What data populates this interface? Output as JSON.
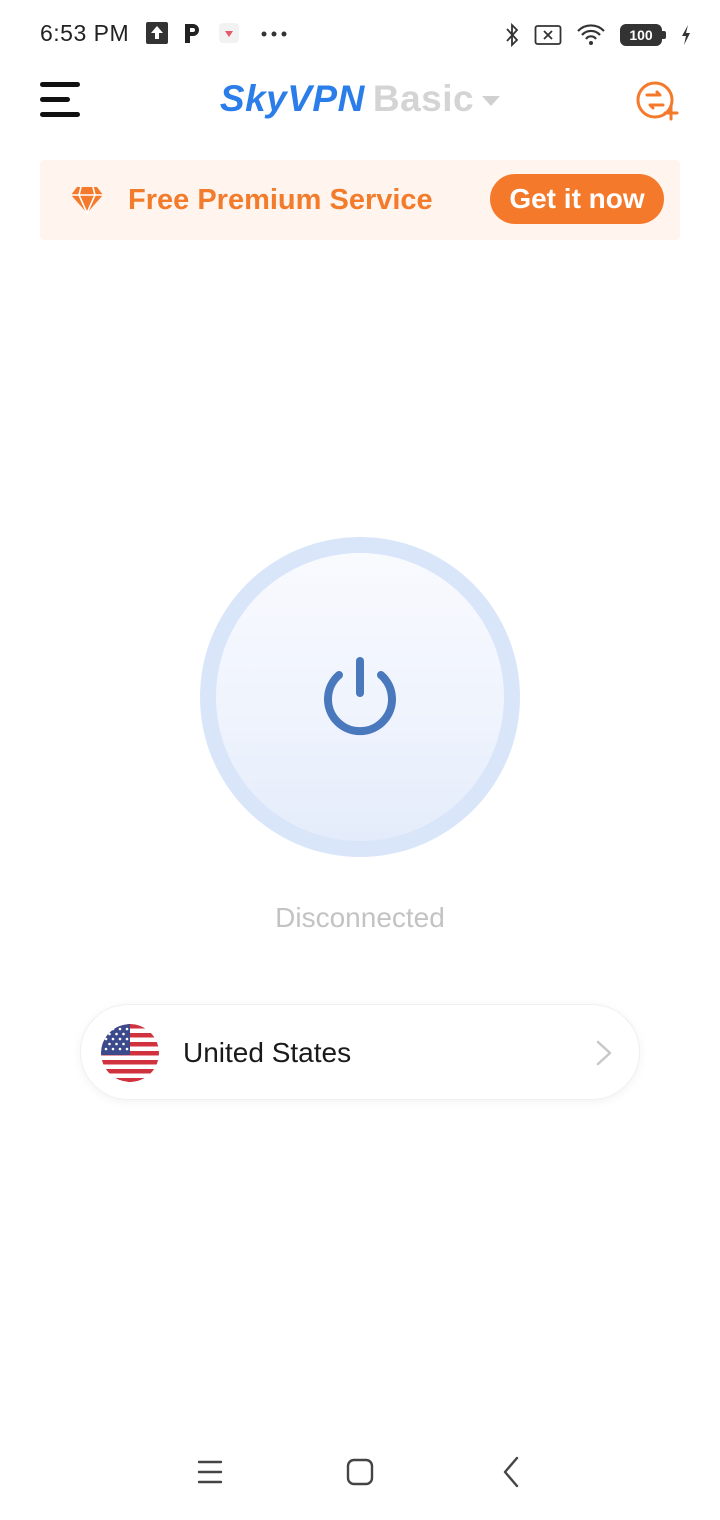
{
  "status_bar": {
    "time": "6:53 PM",
    "battery": "100",
    "icons": [
      "upload-icon",
      "p-app-icon",
      "notification-app-icon",
      "more-dots-icon",
      "bluetooth-icon",
      "sim-error-icon",
      "wifi-icon",
      "battery-icon",
      "charging-icon"
    ]
  },
  "header": {
    "brand_name": "SkyVPN",
    "brand_tier": "Basic",
    "menu_icon": "hamburger-menu-icon",
    "right_icon": "premium-coin-icon"
  },
  "promo": {
    "text": "Free Premium Service",
    "button_label": "Get it now",
    "icon": "diamond-icon"
  },
  "connection": {
    "status": "Disconnected",
    "icon": "power-icon"
  },
  "location": {
    "country": "United States",
    "flag_icon": "us-flag-icon",
    "chevron_icon": "chevron-right-icon"
  },
  "colors": {
    "brand_blue": "#2b7de9",
    "accent_orange": "#f5792b",
    "power_blue": "#4a78bd",
    "status_gray": "#c3c3c3"
  },
  "nav": {
    "icons": [
      "recent-apps-icon",
      "home-icon",
      "back-icon"
    ]
  }
}
